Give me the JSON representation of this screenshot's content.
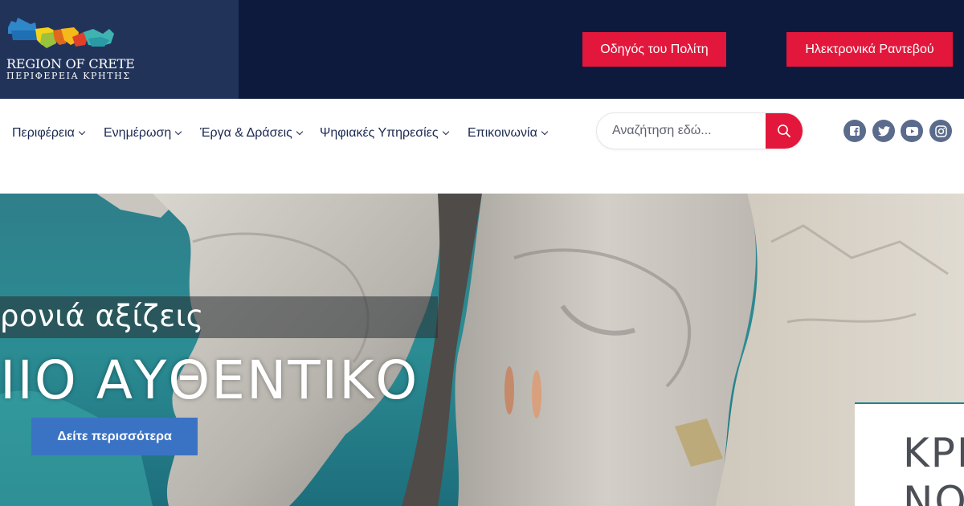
{
  "colors": {
    "topbar_bg": "#0d1a3e",
    "logo_bg": "#22335a",
    "accent_red": "#e2173b",
    "nav_text": "#1c2a52",
    "hero_button": "#3b73c4",
    "social_bg": "#5a6b8c"
  },
  "header": {
    "logo": {
      "name_en": "REGION OF CRETE",
      "name_gr": "ΠΕΡΙΦΕΡΕΙΑ ΚΡΗΤΗΣ",
      "icon": "crete-island-logo"
    },
    "buttons": [
      {
        "label": "Οδηγός του Πολίτη"
      },
      {
        "label": "Ηλεκτρονικά Ραντεβού"
      }
    ]
  },
  "nav": {
    "items": [
      {
        "label": "Περιφέρεια",
        "icon": "chevron-down-icon"
      },
      {
        "label": "Ενημέρωση",
        "icon": "chevron-down-icon"
      },
      {
        "label": "Έργα & Δράσεις",
        "icon": "chevron-down-icon"
      },
      {
        "label": "Ψηφιακές Υπηρεσίες",
        "icon": "chevron-down-icon"
      },
      {
        "label": "Επικοινωνία",
        "icon": "chevron-down-icon"
      }
    ],
    "search": {
      "placeholder": "Αναζήτηση εδώ...",
      "value": "",
      "button_icon": "search-icon"
    },
    "social": [
      "facebook-icon",
      "twitter-icon",
      "youtube-icon",
      "instagram-icon"
    ]
  },
  "hero": {
    "line1": "ρονιά αξίζεις",
    "line2": "ΙΙΟ ΑΥΘΕΝΤΙΚΟ",
    "cta": "Δείτε περισσότερα",
    "side_text1": "ΚΡΗ",
    "side_text2": "ΝΟ"
  }
}
